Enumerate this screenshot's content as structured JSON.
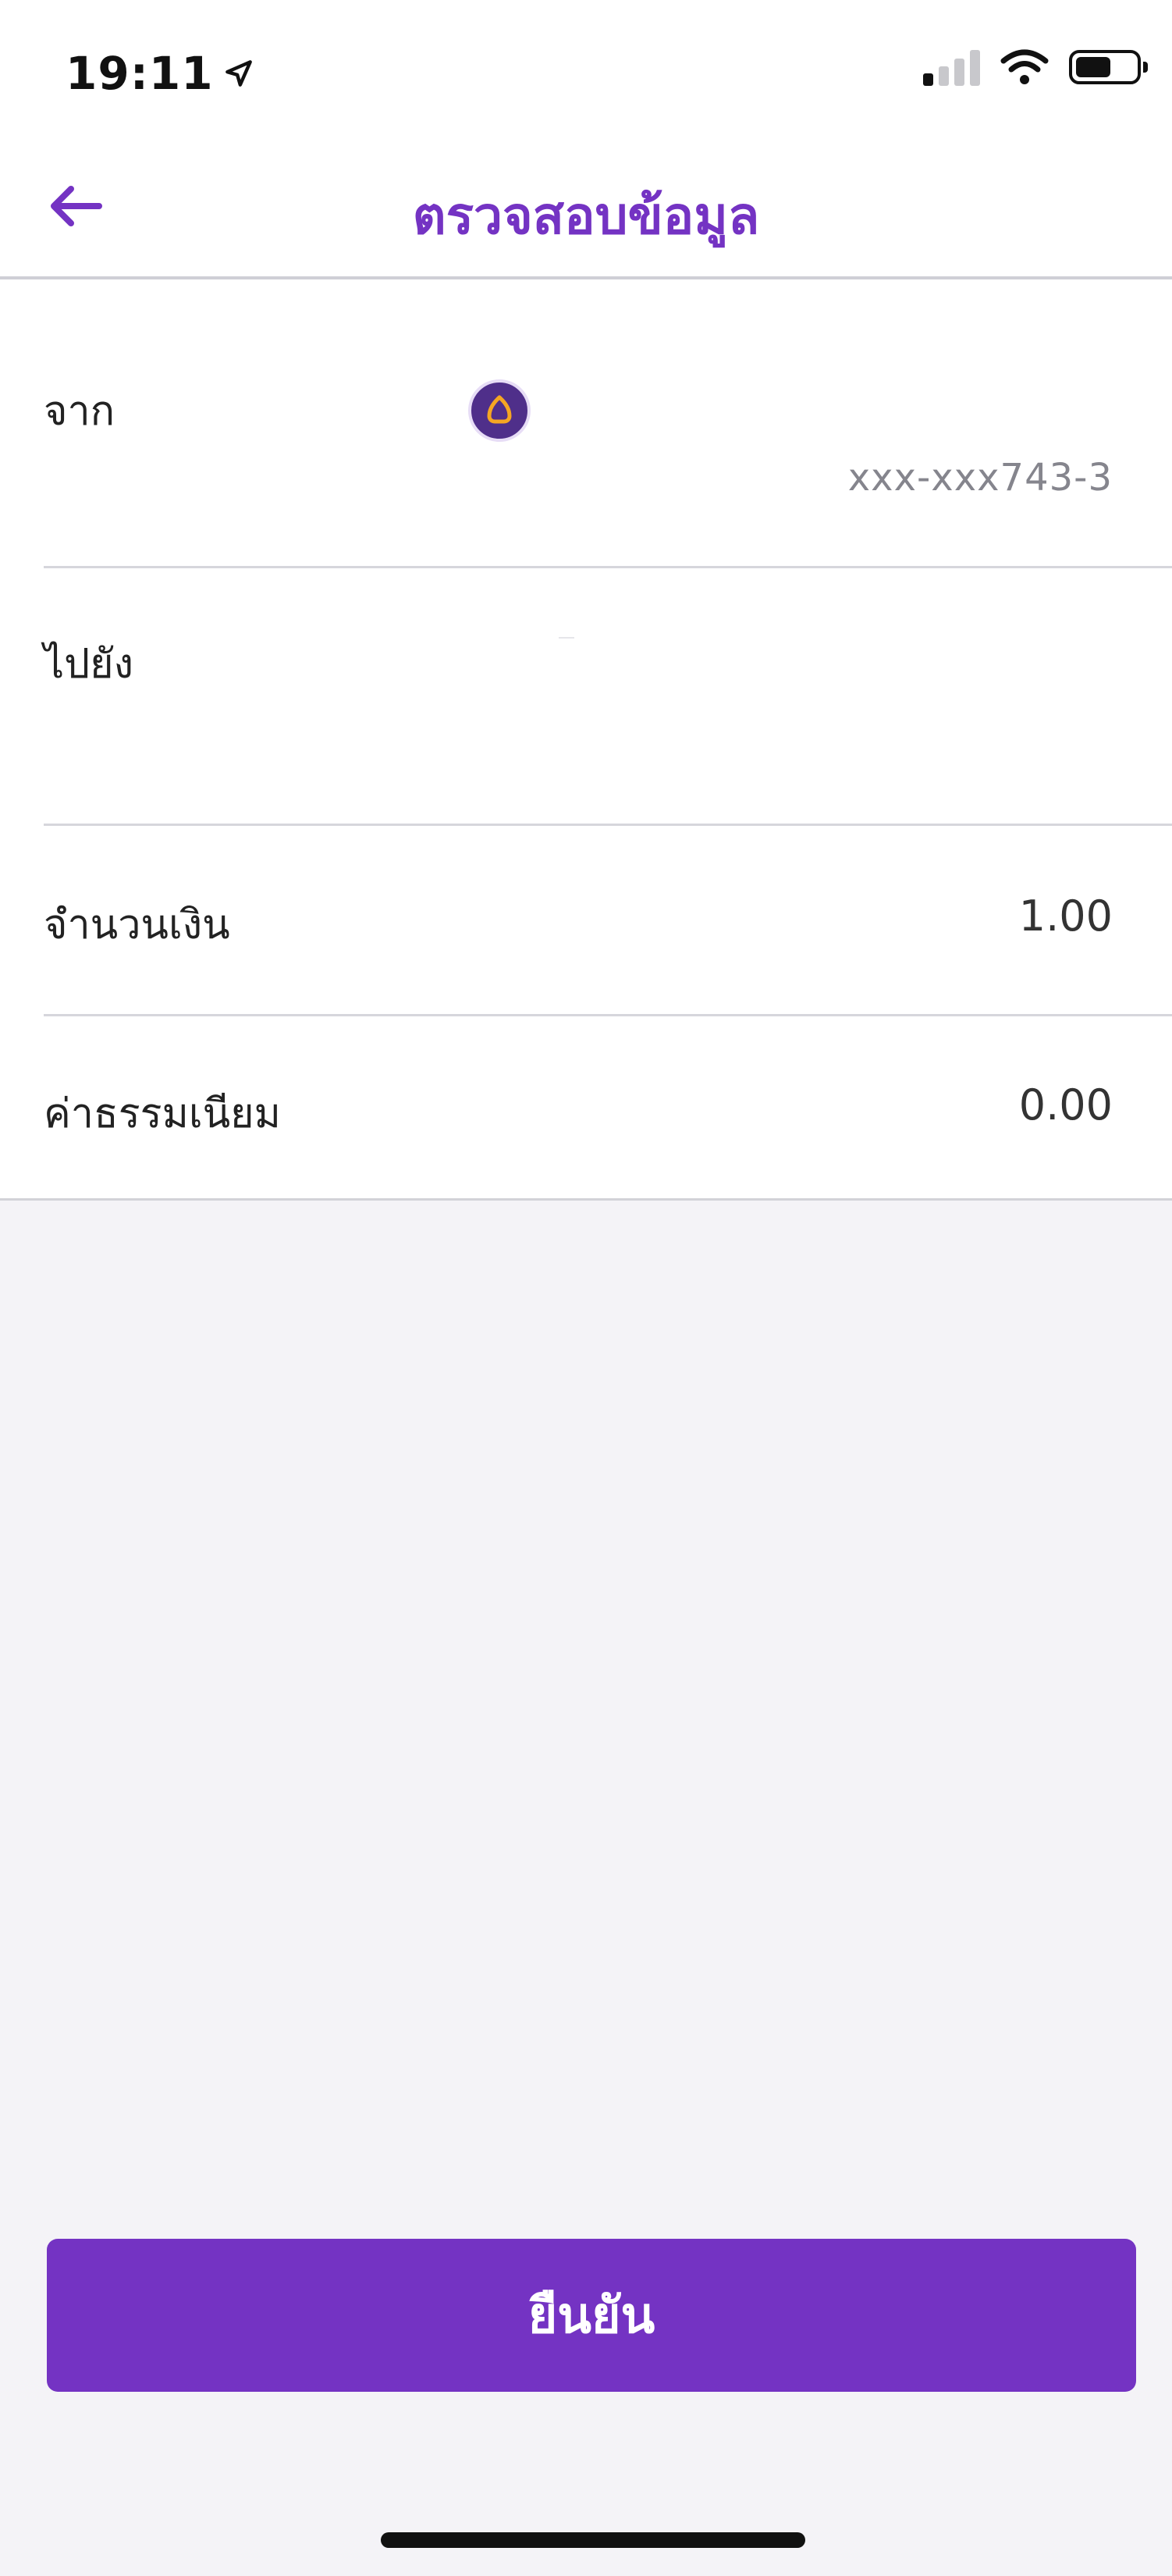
{
  "status_bar": {
    "time": "19:11",
    "location_icon": "location-arrow-icon",
    "signal_icon": "cellular-signal-icon",
    "wifi_icon": "wifi-icon",
    "battery_icon": "battery-icon",
    "battery_level": 0.6
  },
  "nav": {
    "back_icon": "back-arrow-icon",
    "title": "ตรวจสอบข้อมูล"
  },
  "rows": {
    "from": {
      "label": "จาก",
      "bank_icon": "bank-logo-icon",
      "account_number": "xxx-xxx743-3"
    },
    "to": {
      "label": "ไปยัง"
    },
    "amount": {
      "label": "จำนวนเงิน",
      "value": "1.00"
    },
    "fee": {
      "label": "ค่าธรรมเนียม",
      "value": "0.00"
    }
  },
  "confirm_button": {
    "label": "ยืนยัน"
  },
  "colors": {
    "accent": "#7433c3",
    "background": "#f4f3f7",
    "card": "#ffffff",
    "divider": "#d6d6dc",
    "bank_logo_bg": "#4f2f8a",
    "bank_logo_fg": "#f5a623"
  }
}
